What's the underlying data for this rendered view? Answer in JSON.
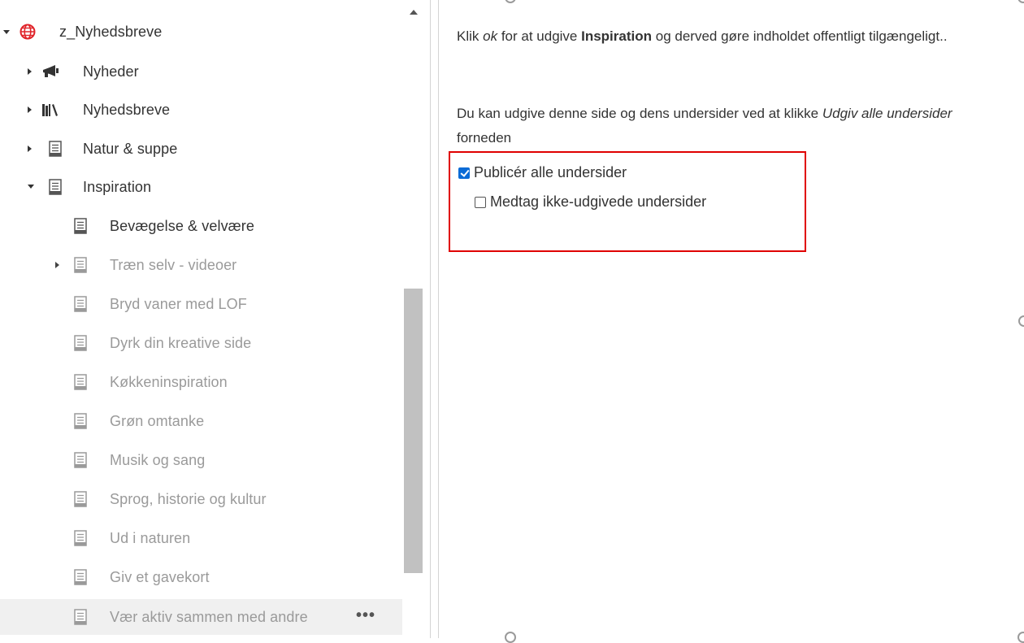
{
  "tree": {
    "root": {
      "label": "z_Nyhedsbreve",
      "expanded": true,
      "icon": "globe-icon"
    },
    "items": [
      {
        "label": "Nyheder",
        "icon": "megaphone-icon",
        "expandable": true,
        "expanded": false,
        "dimmed": false
      },
      {
        "label": "Nyhedsbreve",
        "icon": "books-icon",
        "expandable": true,
        "expanded": false,
        "dimmed": false
      },
      {
        "label": "Natur & suppe",
        "icon": "document-icon",
        "expandable": true,
        "expanded": false,
        "dimmed": false
      },
      {
        "label": "Inspiration",
        "icon": "document-icon",
        "expandable": true,
        "expanded": true,
        "dimmed": false
      },
      {
        "label": "Bevægelse & velvære",
        "icon": "document-icon",
        "expandable": false,
        "dimmed": false
      },
      {
        "label": "Træn selv - videoer",
        "icon": "document-icon",
        "expandable": true,
        "expanded": false,
        "dimmed": true
      },
      {
        "label": "Bryd vaner med LOF",
        "icon": "document-icon",
        "expandable": false,
        "dimmed": true
      },
      {
        "label": "Dyrk din kreative side",
        "icon": "document-icon",
        "expandable": false,
        "dimmed": true
      },
      {
        "label": "Køkkeninspiration",
        "icon": "document-icon",
        "expandable": false,
        "dimmed": true
      },
      {
        "label": "Grøn omtanke",
        "icon": "document-icon",
        "expandable": false,
        "dimmed": true
      },
      {
        "label": "Musik og sang",
        "icon": "document-icon",
        "expandable": false,
        "dimmed": true
      },
      {
        "label": "Sprog, historie og kultur",
        "icon": "document-icon",
        "expandable": false,
        "dimmed": true
      },
      {
        "label": "Ud i naturen",
        "icon": "document-icon",
        "expandable": false,
        "dimmed": true
      },
      {
        "label": "Giv et gavekort",
        "icon": "document-icon",
        "expandable": false,
        "dimmed": true
      },
      {
        "label": "Vær aktiv sammen med andre",
        "icon": "document-icon",
        "expandable": false,
        "dimmed": true,
        "selected": true,
        "more": "•••"
      }
    ]
  },
  "dialog": {
    "intro": {
      "p1": "Klik ",
      "ok": "ok",
      "p2": " for at udgive ",
      "page": "Inspiration",
      "p3": " og derved gøre indholdet offentligt tilgængeligt.."
    },
    "subpages_note": {
      "p1": "Du kan udgive denne side og dens undersider ved at klikke ",
      "em": "Udgiv alle undersider",
      "p2": " forneden"
    },
    "publish_all": {
      "label": "Publicér alle undersider",
      "checked": true
    },
    "include_unpublished": {
      "label": "Medtag ikke-udgivede undersider",
      "checked": false
    }
  },
  "colors": {
    "highlight_border": "#e00000",
    "checkbox_checked": "#0b6bd6",
    "dimmed_text": "#9a9a9a",
    "globe_icon": "#e0242a"
  }
}
